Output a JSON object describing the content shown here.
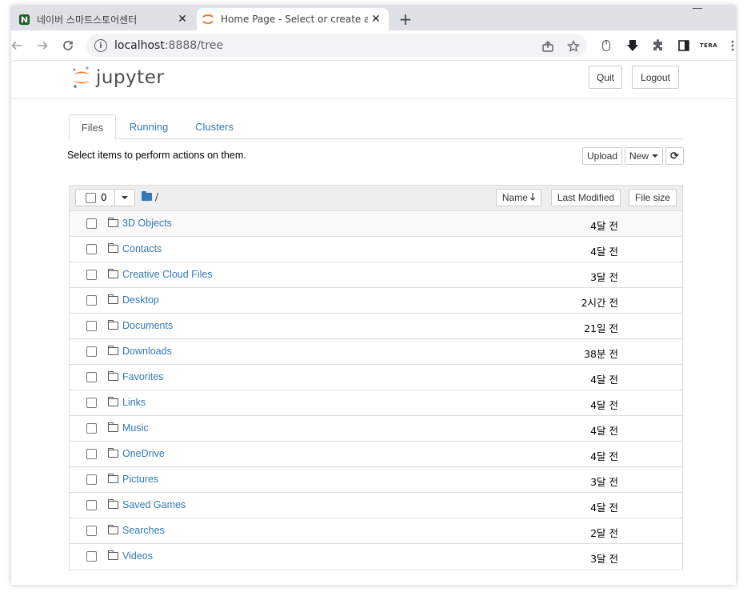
{
  "browser": {
    "tabs": [
      {
        "title": "네이버 스마트스토어센터",
        "active": false,
        "favicon": "naver-smartstore-icon"
      },
      {
        "title": "Home Page - Select or create a",
        "active": true,
        "favicon": "jupyter-icon"
      }
    ],
    "new_tab": "+",
    "close_glyph": "✕",
    "url_host": "localhost",
    "url_rest": ":8888/tree",
    "info_glyph": "i",
    "ext_label": "TERA"
  },
  "header": {
    "logo_text": "jupyter",
    "quit_label": "Quit",
    "logout_label": "Logout"
  },
  "tabs": [
    {
      "label": "Files",
      "active": true
    },
    {
      "label": "Running",
      "active": false
    },
    {
      "label": "Clusters",
      "active": false
    }
  ],
  "toolbar": {
    "hint": "Select items to perform actions on them.",
    "upload_label": "Upload",
    "new_label": "New",
    "refresh_glyph": "⟳"
  },
  "list": {
    "selected_count": "0",
    "breadcrumb": "/",
    "col_name": "Name",
    "col_name_arrow": "🡓",
    "col_modified": "Last Modified",
    "col_size": "File size",
    "items": [
      {
        "name": "3D Objects",
        "modified": "4달 전"
      },
      {
        "name": "Contacts",
        "modified": "4달 전"
      },
      {
        "name": "Creative Cloud Files",
        "modified": "3달 전"
      },
      {
        "name": "Desktop",
        "modified": "2시간 전"
      },
      {
        "name": "Documents",
        "modified": "21일 전"
      },
      {
        "name": "Downloads",
        "modified": "38분 전"
      },
      {
        "name": "Favorites",
        "modified": "4달 전"
      },
      {
        "name": "Links",
        "modified": "4달 전"
      },
      {
        "name": "Music",
        "modified": "4달 전"
      },
      {
        "name": "OneDrive",
        "modified": "4달 전"
      },
      {
        "name": "Pictures",
        "modified": "3달 전"
      },
      {
        "name": "Saved Games",
        "modified": "4달 전"
      },
      {
        "name": "Searches",
        "modified": "2달 전"
      },
      {
        "name": "Videos",
        "modified": "3달 전"
      }
    ]
  },
  "colors": {
    "link": "#337ab7",
    "jupyter_orange": "#f37726",
    "naver_green": "#03c75a"
  }
}
